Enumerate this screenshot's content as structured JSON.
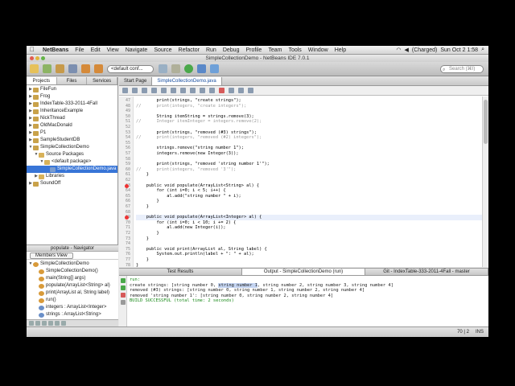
{
  "menubar": {
    "app": "NetBeans",
    "items": [
      "File",
      "Edit",
      "View",
      "Navigate",
      "Source",
      "Refactor",
      "Run",
      "Debug",
      "Profile",
      "Team",
      "Tools",
      "Window",
      "Help"
    ],
    "battery": "(Charged)",
    "clock": "Sun Oct 2 1:58"
  },
  "window": {
    "title": "SimpleCollectionDemo - NetBeans IDE 7.0.1"
  },
  "toolbar": {
    "config": "<default conf...",
    "search_placeholder": "Search (⌘I)"
  },
  "projects": {
    "tabs": [
      "Projects",
      "Files",
      "Services"
    ],
    "tree": [
      {
        "label": "FileFun",
        "level": 0,
        "twisty": "▶",
        "color": "#c9a24a"
      },
      {
        "label": "Frog",
        "level": 0,
        "twisty": "▶",
        "color": "#c9a24a"
      },
      {
        "label": "IndexTable-333-2011-4Fall",
        "level": 0,
        "twisty": "▶",
        "color": "#c9a24a"
      },
      {
        "label": "InheritanceExample",
        "level": 0,
        "twisty": "▶",
        "color": "#c9a24a"
      },
      {
        "label": "NickThread",
        "level": 0,
        "twisty": "▶",
        "color": "#c9a24a"
      },
      {
        "label": "OldMacDonald",
        "level": 0,
        "twisty": "▶",
        "color": "#c9a24a"
      },
      {
        "label": "P1",
        "level": 0,
        "twisty": "▶",
        "color": "#c9a24a"
      },
      {
        "label": "SampleStudentDB",
        "level": 0,
        "twisty": "▶",
        "color": "#c9a24a"
      },
      {
        "label": "SimpleCollectionDemo",
        "level": 0,
        "twisty": "▼",
        "color": "#c9a24a"
      },
      {
        "label": "Source Packages",
        "level": 1,
        "twisty": "▼",
        "color": "#d8b25a"
      },
      {
        "label": "<default package>",
        "level": 2,
        "twisty": "▼",
        "color": "#d8b25a"
      },
      {
        "label": "SimpleCollectionDemo.java",
        "level": 3,
        "twisty": "",
        "color": "#7a9ccf",
        "selected": true
      },
      {
        "label": "Libraries",
        "level": 1,
        "twisty": "▶",
        "color": "#d8b25a"
      },
      {
        "label": "SoundOff",
        "level": 0,
        "twisty": "▶",
        "color": "#c9a24a"
      }
    ]
  },
  "navigator": {
    "header": "populate - Navigator",
    "view": "Members View",
    "members": [
      {
        "label": "SimpleCollectionDemo",
        "level": 0,
        "twisty": "▼",
        "color": "#d89a3a"
      },
      {
        "label": "SimpleCollectionDemo()",
        "level": 1,
        "twisty": "",
        "color": "#d89a3a"
      },
      {
        "label": "main(String[] args)",
        "level": 1,
        "twisty": "",
        "color": "#d89a3a"
      },
      {
        "label": "populate(ArrayList<String> al)",
        "level": 1,
        "twisty": "",
        "color": "#d89a3a"
      },
      {
        "label": "print(ArrayList al, String label)",
        "level": 1,
        "twisty": "",
        "color": "#d89a3a"
      },
      {
        "label": "run()",
        "level": 1,
        "twisty": "",
        "color": "#d89a3a"
      },
      {
        "label": "integers : ArrayList<Integer>",
        "level": 1,
        "twisty": "",
        "color": "#6a8fc8"
      },
      {
        "label": "strings : ArrayList<String>",
        "level": 1,
        "twisty": "",
        "color": "#6a8fc8"
      }
    ]
  },
  "editor": {
    "tabs": [
      "Start Page",
      "SimpleCollectionDemo.java"
    ],
    "active_tab": 1,
    "lines": [
      {
        "n": "47",
        "text": "        print(strings, \"create strings\");",
        "cls": ""
      },
      {
        "n": "48",
        "text": "//      print(integers, \"create integers\");",
        "cls": "cm"
      },
      {
        "n": "49",
        "text": "",
        "cls": ""
      },
      {
        "n": "50",
        "text": "        String itemString = strings.remove(3);",
        "cls": ""
      },
      {
        "n": "51",
        "text": "//      Integer itemInteger = integers.remove(2);",
        "cls": "cm"
      },
      {
        "n": "52",
        "text": "",
        "cls": ""
      },
      {
        "n": "53",
        "text": "        print(strings, \"removed (#3) strings\");",
        "cls": ""
      },
      {
        "n": "54",
        "text": "//      print(integers, \"removed (#2) integers\");",
        "cls": "cm"
      },
      {
        "n": "55",
        "text": "",
        "cls": ""
      },
      {
        "n": "56",
        "text": "        strings.remove(\"string number 1\");",
        "cls": ""
      },
      {
        "n": "57",
        "text": "        integers.remove(new Integer(3));",
        "cls": ""
      },
      {
        "n": "58",
        "text": "",
        "cls": ""
      },
      {
        "n": "59",
        "text": "        print(strings, \"removed 'string number 1'\");",
        "cls": ""
      },
      {
        "n": "60",
        "text": "//      print(integers, \"removed '3'\");",
        "cls": "cm"
      },
      {
        "n": "61",
        "text": "    }",
        "cls": ""
      },
      {
        "n": "62",
        "text": "",
        "cls": ""
      },
      {
        "n": "63",
        "text": "    public void populate(ArrayList<String> al) {",
        "cls": "",
        "err": true
      },
      {
        "n": "64",
        "text": "        for (int i=0; i < 5; i++) {",
        "cls": ""
      },
      {
        "n": "65",
        "text": "            al.add(\"string number \" + i);",
        "cls": ""
      },
      {
        "n": "66",
        "text": "        }",
        "cls": ""
      },
      {
        "n": "67",
        "text": "    }",
        "cls": ""
      },
      {
        "n": "68",
        "text": "",
        "cls": ""
      },
      {
        "n": "69",
        "text": "    public void populate(ArrayList<Integer> al) {",
        "cls": "hl",
        "err": true
      },
      {
        "n": "70",
        "text": "        for (int i=0; i < 10; i += 2) {",
        "cls": ""
      },
      {
        "n": "71",
        "text": "            al.add(new Integer(i));",
        "cls": ""
      },
      {
        "n": "72",
        "text": "        }",
        "cls": ""
      },
      {
        "n": "73",
        "text": "    }",
        "cls": ""
      },
      {
        "n": "74",
        "text": "",
        "cls": ""
      },
      {
        "n": "75",
        "text": "    public void print(ArrayList al, String label) {",
        "cls": ""
      },
      {
        "n": "76",
        "text": "        System.out.println(label + \": \" + al);",
        "cls": ""
      },
      {
        "n": "77",
        "text": "    }",
        "cls": ""
      },
      {
        "n": "78",
        "text": "}",
        "cls": ""
      },
      {
        "n": "79",
        "text": "",
        "cls": ""
      }
    ]
  },
  "output": {
    "tabs": [
      "Test Results",
      "Output - SimpleCollectionDemo (run)",
      "Git - IndexTable-333-2011-4Fall - master"
    ],
    "active_tab": 1,
    "lines": [
      {
        "text": "run:",
        "cls": "g"
      },
      {
        "pre": "create strings: [string number 0, ",
        "mark": "string number 1",
        "post": ", string number 2, string number 3, string number 4]"
      },
      {
        "text": "removed (#3) strings: [string number 0, string number 1, string number 2, string number 4]"
      },
      {
        "text": "removed 'string number 1': [string number 0, string number 2, string number 4]"
      },
      {
        "text": "BUILD SUCCESSFUL (total time: 2 seconds)",
        "cls": "g"
      }
    ]
  },
  "status": {
    "position": "70 | 2",
    "mode": "INS"
  }
}
